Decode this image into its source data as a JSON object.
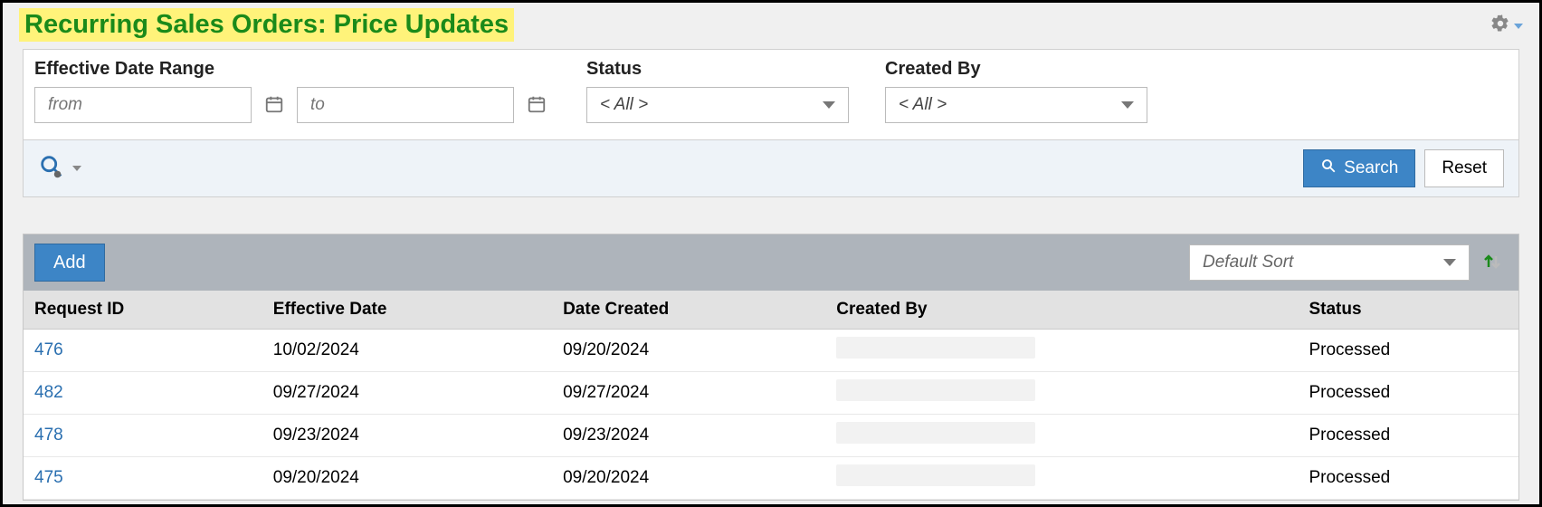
{
  "pageTitle": "Recurring Sales Orders: Price Updates",
  "filters": {
    "dateRangeLabel": "Effective Date Range",
    "fromPlaceholder": "from",
    "toPlaceholder": "to",
    "statusLabel": "Status",
    "statusValue": "< All >",
    "createdByLabel": "Created By",
    "createdByValue": "< All >"
  },
  "actions": {
    "searchLabel": "Search",
    "resetLabel": "Reset"
  },
  "grid": {
    "addLabel": "Add",
    "sortLabel": "Default Sort",
    "columns": {
      "requestId": "Request ID",
      "effectiveDate": "Effective Date",
      "dateCreated": "Date Created",
      "createdBy": "Created By",
      "status": "Status"
    },
    "rows": [
      {
        "requestId": "476",
        "effectiveDate": "10/02/2024",
        "dateCreated": "09/20/2024",
        "createdBy": "",
        "status": "Processed"
      },
      {
        "requestId": "482",
        "effectiveDate": "09/27/2024",
        "dateCreated": "09/27/2024",
        "createdBy": "",
        "status": "Processed"
      },
      {
        "requestId": "478",
        "effectiveDate": "09/23/2024",
        "dateCreated": "09/23/2024",
        "createdBy": "",
        "status": "Processed"
      },
      {
        "requestId": "475",
        "effectiveDate": "09/20/2024",
        "dateCreated": "09/20/2024",
        "createdBy": "",
        "status": "Processed"
      }
    ]
  }
}
